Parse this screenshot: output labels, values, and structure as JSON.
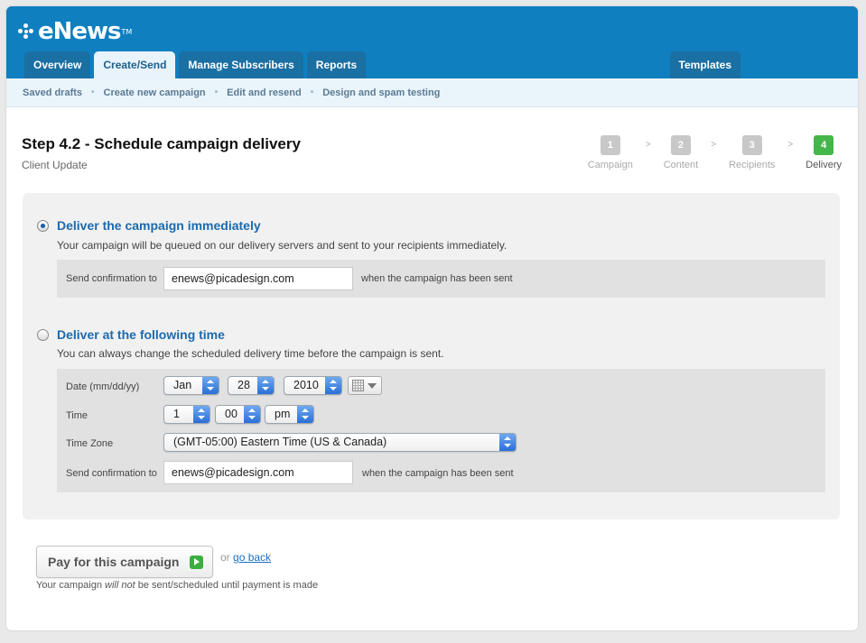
{
  "app": {
    "logo_text": "eNews",
    "logo_mark": "TM"
  },
  "tabs": [
    {
      "label": "Overview"
    },
    {
      "label": "Create/Send"
    },
    {
      "label": "Manage Subscribers"
    },
    {
      "label": "Reports"
    }
  ],
  "templates_tab": "Templates",
  "subnav": [
    "Saved drafts",
    "Create new campaign",
    "Edit and resend",
    "Design and spam testing"
  ],
  "subnav_separator": "•",
  "page": {
    "title": "Step 4.2 - Schedule campaign delivery",
    "subtitle": "Client Update"
  },
  "steps": [
    {
      "num": "1",
      "label": "Campaign"
    },
    {
      "num": "2",
      "label": "Content"
    },
    {
      "num": "3",
      "label": "Recipients"
    },
    {
      "num": "4",
      "label": "Delivery"
    }
  ],
  "step_separator": ">",
  "immediate": {
    "title": "Deliver the campaign immediately",
    "description": "Your campaign will be queued on our delivery servers and sent to your recipients immediately.",
    "confirm_label": "Send confirmation to",
    "confirm_value": "enews@picadesign.com",
    "confirm_after": "when the campaign has been sent"
  },
  "scheduled": {
    "title": "Deliver at the following time",
    "description": "You can always change the scheduled delivery time before the campaign is sent.",
    "date_label": "Date (mm/dd/yy)",
    "month": "Jan",
    "day": "28",
    "year": "2010",
    "time_label": "Time",
    "hour": "1",
    "minute": "00",
    "ampm": "pm",
    "tz_label": "Time Zone",
    "timezone": "(GMT-05:00) Eastern Time (US & Canada)",
    "confirm_label": "Send confirmation to",
    "confirm_value": "enews@picadesign.com",
    "confirm_after": "when the campaign has been sent"
  },
  "footer": {
    "pay_label": "Pay for this campaign",
    "or_text": "or",
    "go_back": "go back",
    "note_before": "Your campaign ",
    "note_em": "will not",
    "note_after": " be sent/scheduled until payment is made"
  },
  "colors": {
    "brand_blue": "#0f7fc0",
    "active_step": "#45b649",
    "link_blue": "#1b6aae"
  }
}
